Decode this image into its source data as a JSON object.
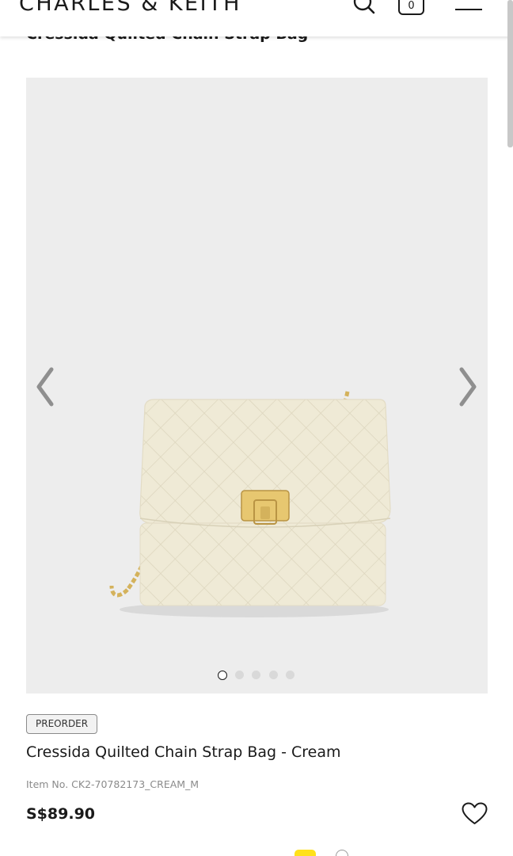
{
  "header": {
    "logo_text": "CHARLES & KEITH",
    "cart_count": "0",
    "icons": [
      "search-icon",
      "shopping-bag-icon",
      "hamburger-menu-icon"
    ]
  },
  "sticky_title": "Cressida Quilted Chain Strap Bag",
  "gallery": {
    "image_alt": "Cressida Quilted Chain Strap Bag - Cream",
    "slide_count": 5,
    "active_slide": 1,
    "icons": [
      "chevron-left-icon",
      "chevron-right-icon"
    ]
  },
  "product": {
    "badge": "PREORDER",
    "title": "Cressida Quilted Chain Strap Bag - Cream",
    "item_no": "Item No. CK2-70782173_CREAM_M",
    "price": "S$89.90",
    "wishlist_icon": "heart-outline-icon"
  },
  "colors": {
    "bag": "#efead6",
    "hardware": "#d4b25c",
    "gallery_bg": "#ededed",
    "swatch_highlight": "#ffe11a"
  }
}
